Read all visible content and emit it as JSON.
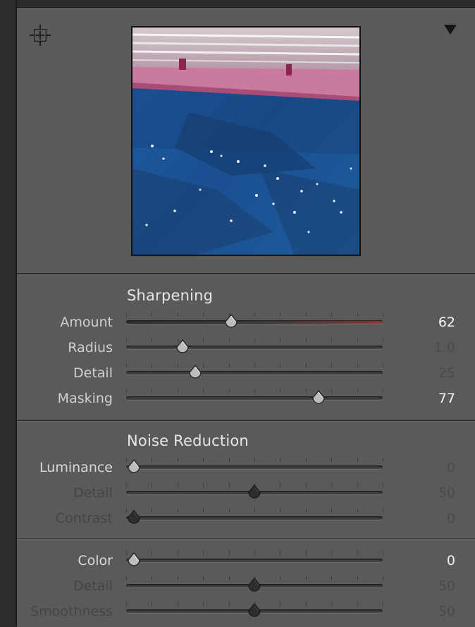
{
  "header": {
    "target_icon": "crosshair-target-icon",
    "collapse_icon": "triangle-down-icon"
  },
  "sharpening": {
    "title": "Sharpening",
    "rows": [
      {
        "label": "Amount",
        "value": "62",
        "position": 0.41,
        "active": true
      },
      {
        "label": "Radius",
        "value": "1.0",
        "position": 0.22,
        "active": true
      },
      {
        "label": "Detail",
        "value": "25",
        "position": 0.27,
        "active": true
      },
      {
        "label": "Masking",
        "value": "77",
        "position": 0.75,
        "active": true
      }
    ]
  },
  "noise_reduction": {
    "title": "Noise Reduction",
    "luminance_rows": [
      {
        "label": "Luminance",
        "value": "0",
        "position": 0.03,
        "active": true
      },
      {
        "label": "Detail",
        "value": "50",
        "position": 0.5,
        "active": false
      },
      {
        "label": "Contrast",
        "value": "0",
        "position": 0.03,
        "active": false
      }
    ],
    "color_rows": [
      {
        "label": "Color",
        "value": "0",
        "position": 0.03,
        "active": true
      },
      {
        "label": "Detail",
        "value": "50",
        "position": 0.5,
        "active": false
      },
      {
        "label": "Smoothness",
        "value": "50",
        "position": 0.5,
        "active": false
      }
    ]
  },
  "colors": {
    "panel_bg": "#5a5a5a",
    "amount_track_accent": "#8a3b3b"
  }
}
